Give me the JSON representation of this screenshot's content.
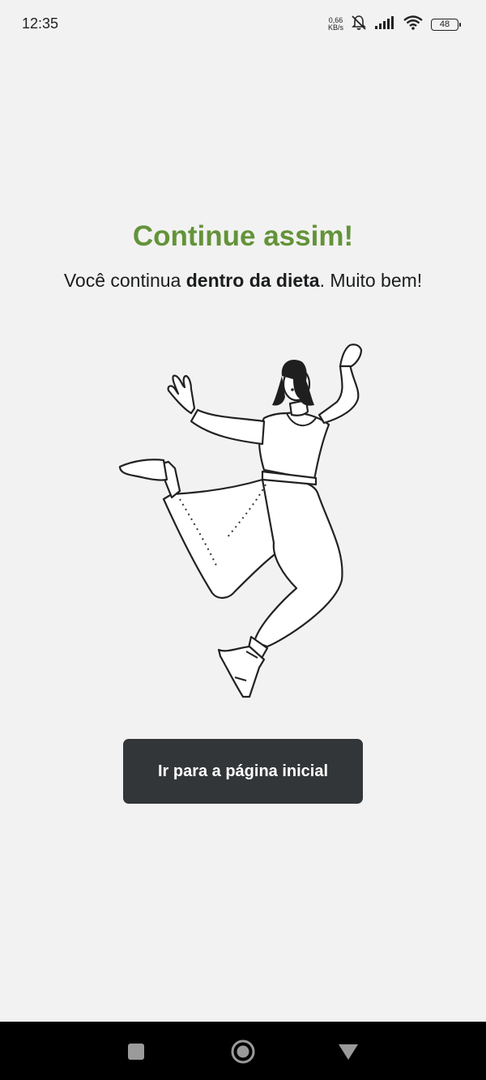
{
  "status_bar": {
    "time": "12:35",
    "net_speed_value": "0,66",
    "net_speed_unit": "KB/s",
    "battery": "48",
    "icons": [
      "mute-bell-icon",
      "signal-icon",
      "wifi-icon",
      "battery-icon"
    ]
  },
  "main": {
    "title": "Continue assim!",
    "subtitle_pre": "Você continua ",
    "subtitle_bold": "dentro da dieta",
    "subtitle_post": ". Muito bem!",
    "illustration": "jumping-woman-illustration",
    "button_label": "Ir para a página inicial"
  },
  "nav_bar": {
    "buttons": [
      "recents-square-icon",
      "home-circle-icon",
      "back-triangle-icon"
    ]
  },
  "colors": {
    "background": "#f2f2f2",
    "title_green": "#639339",
    "button_dark": "#333638",
    "nav_bar": "#000000"
  }
}
